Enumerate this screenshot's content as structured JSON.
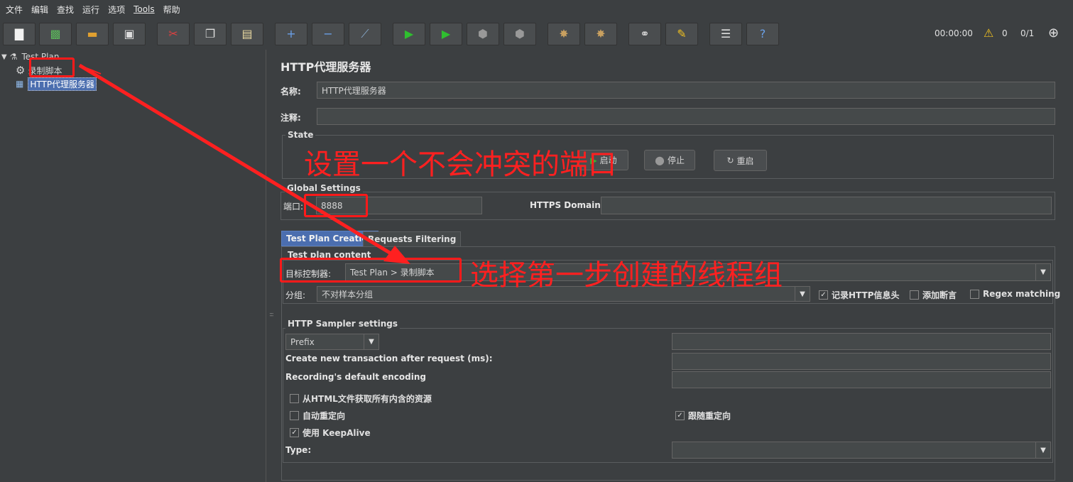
{
  "menu": [
    "文件",
    "编辑",
    "查找",
    "运行",
    "选项",
    "Tools",
    "帮助"
  ],
  "toolbar": {
    "icons": [
      "new-icon",
      "templates-icon",
      "open-icon",
      "save-icon",
      "cut-icon",
      "copy-icon",
      "paste-icon",
      "expand-icon",
      "collapse-icon",
      "toggle-icon",
      "start-icon",
      "start-no-pause-icon",
      "stop-icon",
      "shutdown-icon",
      "clear-icon",
      "clear-all-icon",
      "search-icon",
      "reset-search-icon",
      "function-helper-icon",
      "help-icon"
    ],
    "timer": "00:00:00",
    "warning_count": "0",
    "threads": "0/1"
  },
  "tree": {
    "root": "Test Plan",
    "items": [
      "录制脚本",
      "HTTP代理服务器"
    ]
  },
  "panel": {
    "title": "HTTP代理服务器",
    "name_label": "名称:",
    "name_value": "HTTP代理服务器",
    "comment_label": "注释:",
    "comment_value": "",
    "state_title": "State",
    "start_button": "启动",
    "stop_button": "停止",
    "restart_button": "重启",
    "global_title": "Global Settings",
    "port_label": "端口:",
    "port_value": "8888",
    "https_label": "HTTPS Domains:",
    "https_value": "",
    "tabs": [
      "Test Plan Creation",
      "Requests Filtering"
    ],
    "content_title": "Test plan content",
    "target_label": "目标控制器:",
    "target_value": "Test Plan > 录制脚本",
    "group_label": "分组:",
    "group_value": "不对样本分组",
    "record_headers": "记录HTTP信息头",
    "add_assertions": "添加断言",
    "regex_matching": "Regex matching",
    "sampler_title": "HTTP Sampler settings",
    "prefix_value": "Prefix",
    "prefix_field": "",
    "transaction_label": "Create new transaction after request (ms):",
    "transaction_value": "",
    "encoding_label": "Recording's default encoding",
    "encoding_value": "",
    "retrieve_resources": "从HTML文件获取所有内含的资源",
    "auto_redirect": "自动重定向",
    "follow_redirect": "跟随重定向",
    "keepalive": "使用 KeepAlive",
    "type_label": "Type:",
    "type_value": ""
  },
  "annotations": {
    "port_note": "设置一个不会冲突的端口",
    "group_note": "选择第一步创建的线程组"
  },
  "colors": {
    "background": "#3c3f41",
    "selection": "#4b6eaf",
    "annotation": "#ff2020",
    "play": "#2fbf2f"
  }
}
